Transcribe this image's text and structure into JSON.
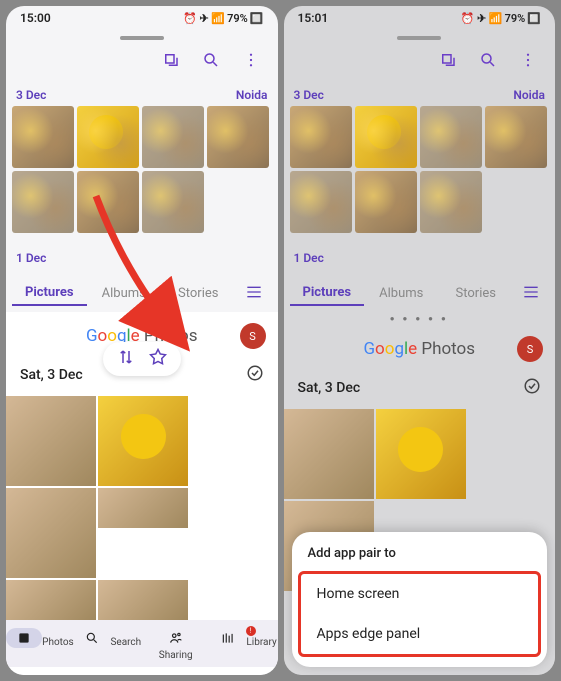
{
  "left": {
    "status": {
      "time": "15:00",
      "battery": "79%"
    },
    "gallery": {
      "date1": "3 Dec",
      "loc1": "Noida",
      "date2": "1 Dec",
      "tabs": [
        "Pictures",
        "Albums",
        "Stories"
      ]
    },
    "gphotos": {
      "logo": "Google Photos",
      "avatar": "S",
      "date": "Sat, 3 Dec",
      "nav": [
        "Photos",
        "Search",
        "Sharing",
        "Library"
      ]
    }
  },
  "right": {
    "status": {
      "time": "15:01",
      "battery": "79%"
    },
    "gallery": {
      "date1": "3 Dec",
      "loc1": "Noida",
      "date2": "1 Dec",
      "tabs": [
        "Pictures",
        "Albums",
        "Stories"
      ]
    },
    "gphotos": {
      "logo": "Google Photos",
      "avatar": "S",
      "date": "Sat, 3 Dec"
    },
    "sheet": {
      "title": "Add app pair to",
      "opt1": "Home screen",
      "opt2": "Apps edge panel"
    }
  }
}
